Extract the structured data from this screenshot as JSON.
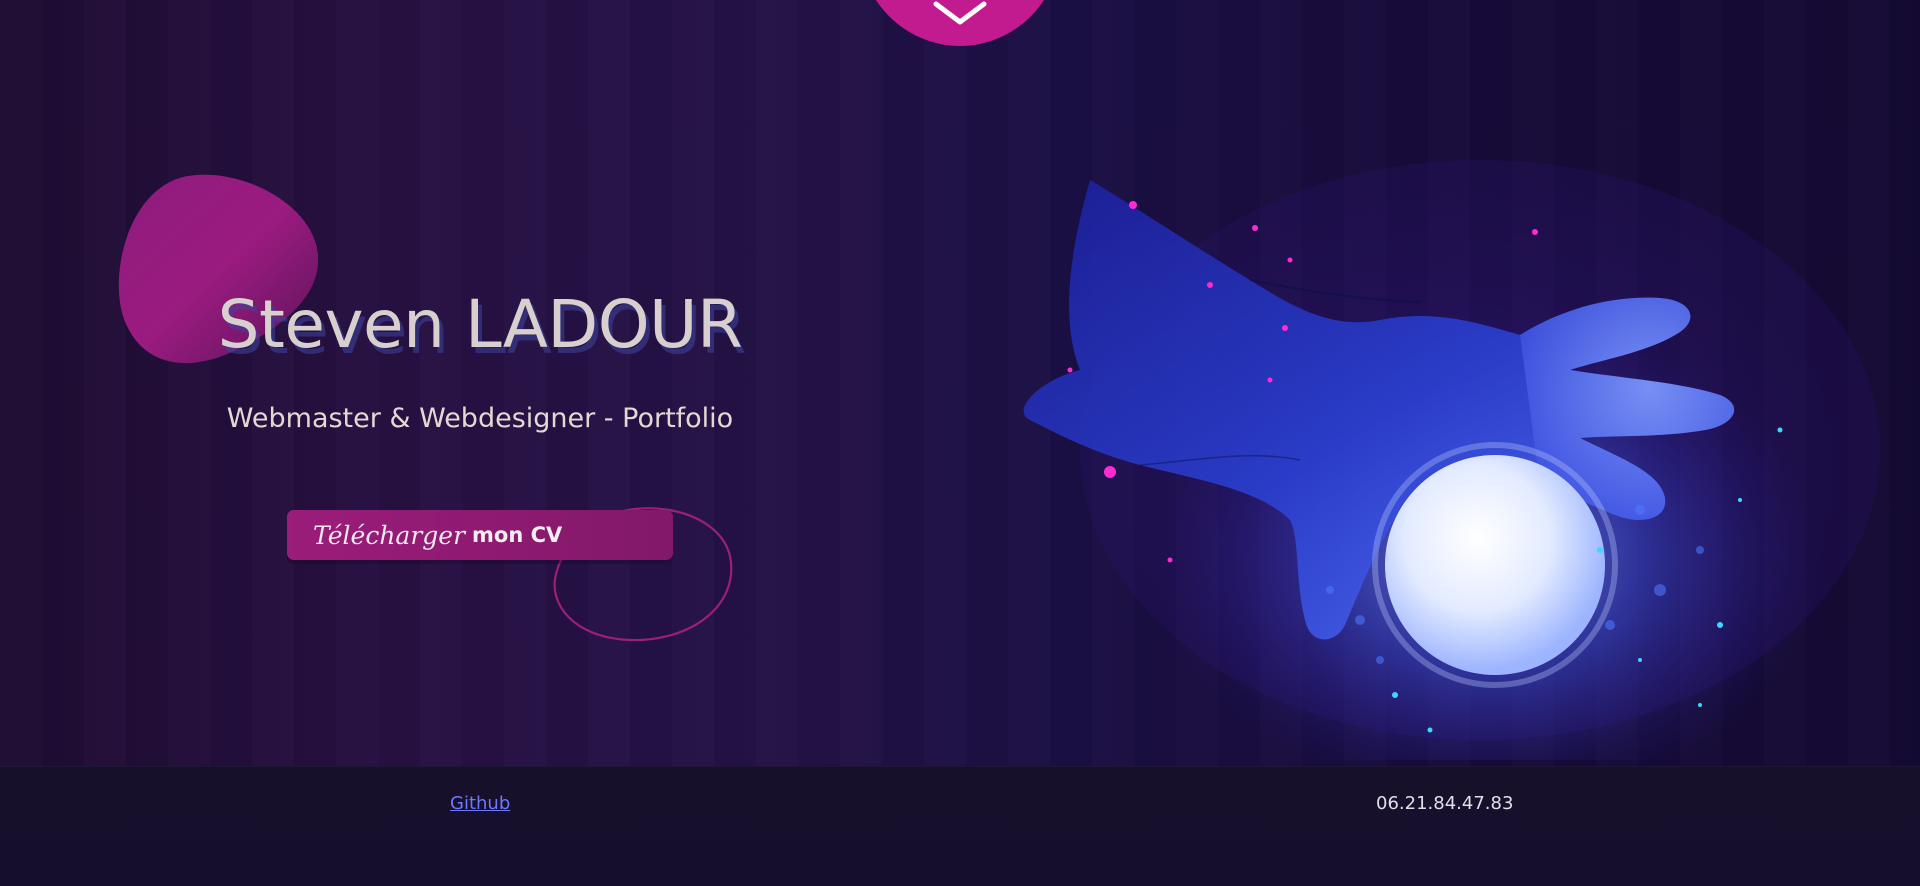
{
  "hero": {
    "name": "Steven LADOUR",
    "subtitle": "Webmaster & Webdesigner - Portfolio",
    "cv_button": {
      "script_label": "Télécharger",
      "rest_label": "mon CV"
    },
    "scroll_icon": "chevron-down-icon",
    "illustration": "glowing-hand-orb"
  },
  "footer": {
    "github_label": "Github",
    "phone": "06.21.84.47.83"
  },
  "colors": {
    "accent_magenta": "#c21a8f",
    "cv_button": "#9b1c7a",
    "link_blue": "#6e78ff",
    "background_dark": "#1f0c33"
  }
}
